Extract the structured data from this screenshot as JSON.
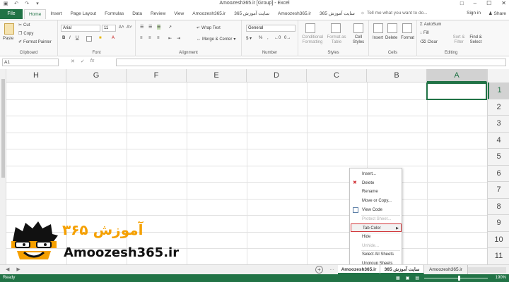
{
  "window": {
    "title": "Amoozesh365.ir  [Group]  -  Excel",
    "signin": "Sign in",
    "share": "Share"
  },
  "tabs": {
    "file": "File",
    "items": [
      "Home",
      "Insert",
      "Page Layout",
      "Formulas",
      "Data",
      "Review",
      "View",
      "Amoozesh365.ir",
      "سایت آموزش 365",
      "Amoozesh365.ir",
      "سایت آموزش 365"
    ],
    "tellme": "Tell me what you want to do..."
  },
  "ribbon": {
    "clipboard": {
      "label": "Clipboard",
      "paste": "Paste",
      "cut": "Cut",
      "copy": "Copy",
      "format_painter": "Format Painter"
    },
    "font": {
      "label": "Font",
      "name": "Arial",
      "size": "11"
    },
    "alignment": {
      "label": "Alignment",
      "wrap": "Wrap Text",
      "merge": "Merge & Center"
    },
    "number": {
      "label": "Number",
      "format": "General"
    },
    "styles": {
      "label": "Styles",
      "conditional": "Conditional Formatting",
      "format_table": "Format as Table",
      "cell_styles": "Cell Styles"
    },
    "cells": {
      "label": "Cells",
      "insert": "Insert",
      "delete": "Delete",
      "format": "Format"
    },
    "editing": {
      "label": "Editing",
      "autosum": "AutoSum",
      "fill": "Fill",
      "clear": "Clear",
      "sort": "Sort & Filter",
      "find": "Find & Select"
    }
  },
  "formula": {
    "namebox": "A1",
    "fx": "fx"
  },
  "grid": {
    "columns": [
      "H",
      "G",
      "F",
      "E",
      "D",
      "C",
      "B",
      "A"
    ],
    "rows": [
      "1",
      "2",
      "3",
      "4",
      "5",
      "6",
      "7",
      "8",
      "9",
      "10",
      "11"
    ]
  },
  "context_menu": {
    "items": [
      {
        "label": "Insert...",
        "disabled": false
      },
      {
        "label": "Delete",
        "disabled": false
      },
      {
        "label": "Rename",
        "disabled": false
      },
      {
        "label": "Move or Copy...",
        "disabled": false
      },
      {
        "label": "View Code",
        "disabled": false
      },
      {
        "label": "Protect Sheet...",
        "disabled": true
      },
      {
        "label": "Tab Color",
        "disabled": false
      },
      {
        "label": "Hide",
        "disabled": false
      },
      {
        "label": "Unhide...",
        "disabled": true
      },
      {
        "label": "Select All Sheets",
        "disabled": false
      },
      {
        "label": "Ungroup Sheets",
        "disabled": false
      }
    ]
  },
  "sheets": [
    "Amoozesh365.ir",
    "سایت آموزش 365",
    "Amoozesh365.ir"
  ],
  "status": {
    "ready": "Ready",
    "zoom": "190%"
  },
  "logo": {
    "brand": "Amoozesh365.ir",
    "fa": "آموزش ۳۶۵"
  },
  "colors": {
    "excel_green": "#217346",
    "highlight_red": "#d13438",
    "logo_orange": "#f5a000"
  }
}
